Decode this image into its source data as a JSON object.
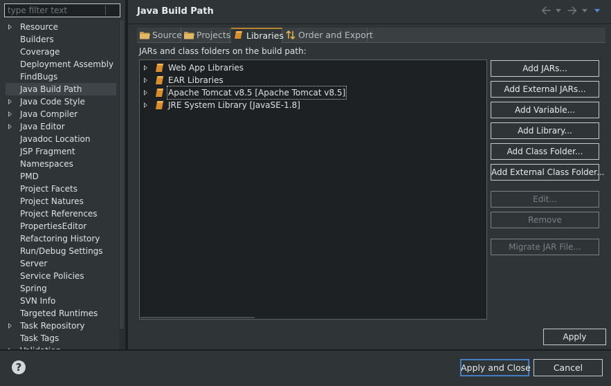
{
  "filter": {
    "placeholder": "type filter text"
  },
  "nav_items": [
    {
      "label": "Resource",
      "expandable": true
    },
    {
      "label": "Builders",
      "expandable": false
    },
    {
      "label": "Coverage",
      "expandable": false
    },
    {
      "label": "Deployment Assembly",
      "expandable": false
    },
    {
      "label": "FindBugs",
      "expandable": false
    },
    {
      "label": "Java Build Path",
      "expandable": false,
      "selected": true
    },
    {
      "label": "Java Code Style",
      "expandable": true
    },
    {
      "label": "Java Compiler",
      "expandable": true
    },
    {
      "label": "Java Editor",
      "expandable": true
    },
    {
      "label": "Javadoc Location",
      "expandable": false
    },
    {
      "label": "JSP Fragment",
      "expandable": false
    },
    {
      "label": "Namespaces",
      "expandable": false
    },
    {
      "label": "PMD",
      "expandable": false
    },
    {
      "label": "Project Facets",
      "expandable": false
    },
    {
      "label": "Project Natures",
      "expandable": false
    },
    {
      "label": "Project References",
      "expandable": false
    },
    {
      "label": "PropertiesEditor",
      "expandable": false
    },
    {
      "label": "Refactoring History",
      "expandable": false
    },
    {
      "label": "Run/Debug Settings",
      "expandable": false
    },
    {
      "label": "Server",
      "expandable": false
    },
    {
      "label": "Service Policies",
      "expandable": false
    },
    {
      "label": "Spring",
      "expandable": false
    },
    {
      "label": "SVN Info",
      "expandable": false
    },
    {
      "label": "Targeted Runtimes",
      "expandable": false
    },
    {
      "label": "Task Repository",
      "expandable": true
    },
    {
      "label": "Task Tags",
      "expandable": false
    },
    {
      "label": "Validation",
      "expandable": true
    }
  ],
  "page": {
    "title": "Java Build Path"
  },
  "tabs": [
    {
      "label": "Source",
      "icon": "source-folder-icon"
    },
    {
      "label": "Projects",
      "icon": "projects-folder-icon"
    },
    {
      "label": "Libraries",
      "icon": "libraries-icon",
      "active": true
    },
    {
      "label": "Order and Export",
      "icon": "order-export-icon"
    }
  ],
  "libraries": {
    "label": "JARs and class folders on the build path:",
    "items": [
      {
        "label": "Web App Libraries"
      },
      {
        "label": "EAR Libraries"
      },
      {
        "label": "Apache Tomcat v8.5 [Apache Tomcat v8.5]",
        "focused": true
      },
      {
        "label": "JRE System Library [JavaSE-1.8]"
      }
    ]
  },
  "buttons": {
    "add_jars": "Add JARs...",
    "add_external_jars": "Add External JARs...",
    "add_variable": "Add Variable...",
    "add_library": "Add Library...",
    "add_class_folder": "Add Class Folder...",
    "add_external_class_folder": "Add External Class Folder...",
    "edit": "Edit...",
    "remove": "Remove",
    "migrate_jar": "Migrate JAR File...",
    "apply": "Apply"
  },
  "dialog": {
    "help": "?",
    "apply_and_close": "Apply and Close",
    "cancel": "Cancel"
  },
  "colors": {
    "background": "#2f3437",
    "tree_background": "#1e2123",
    "accent_tab": "#b6862e",
    "default_button_border": "#4f8ed8"
  }
}
